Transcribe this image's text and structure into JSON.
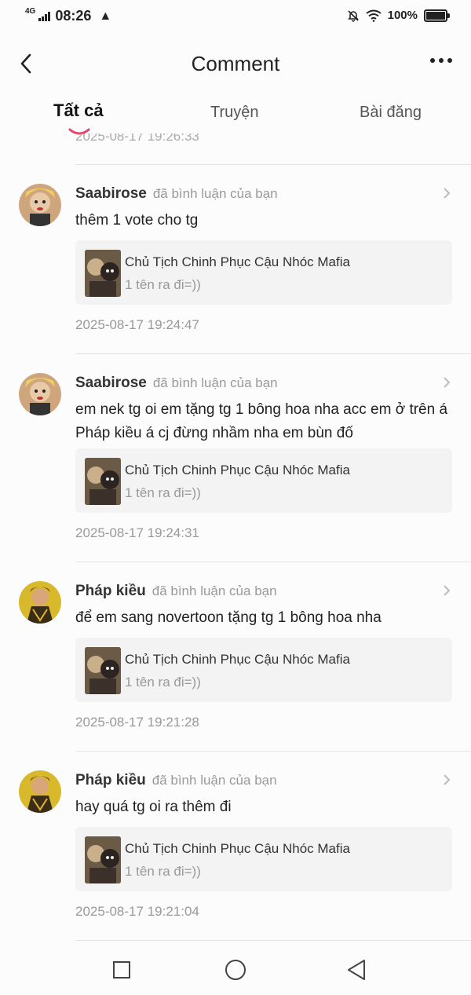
{
  "status_bar": {
    "network": "4G",
    "time": "08:26",
    "battery": "100%"
  },
  "header": {
    "title": "Comment"
  },
  "tabs": [
    {
      "label": "Tất cả",
      "active": true
    },
    {
      "label": "Truyện",
      "active": false
    },
    {
      "label": "Bài đăng",
      "active": false
    }
  ],
  "cut_timestamp": "2025-08-17 19:26:33",
  "items": [
    {
      "user": "Saabirose",
      "action": "đã bình luận của bạn",
      "text": "thêm 1 vote cho tg",
      "card_title": "Chủ Tịch Chinh Phục Cậu Nhóc Mafia",
      "card_sub": "1 tên ra đi=))",
      "timestamp": "2025-08-17 19:24:47"
    },
    {
      "user": "Saabirose",
      "action": "đã bình luận của bạn",
      "text": "em nek tg oi em tặng tg 1 bông hoa nha acc em ở trên á Pháp kiều á cj đừng nhầm nha em bùn đố",
      "card_title": "Chủ Tịch Chinh Phục Cậu Nhóc Mafia",
      "card_sub": "1 tên ra đi=))",
      "timestamp": "2025-08-17 19:24:31"
    },
    {
      "user": "Pháp kiều",
      "action": "đã bình luận của bạn",
      "text": "để em sang novertoon tặng tg 1 bông hoa nha",
      "card_title": "Chủ Tịch Chinh Phục Cậu Nhóc Mafia",
      "card_sub": "1 tên ra đi=))",
      "timestamp": "2025-08-17 19:21:28"
    },
    {
      "user": "Pháp kiều",
      "action": "đã bình luận của bạn",
      "text": "hay quá tg oi ra thêm đi",
      "card_title": "Chủ Tịch Chinh Phục Cậu Nhóc Mafia",
      "card_sub": "1 tên ra đi=))",
      "timestamp": "2025-08-17 19:21:04"
    }
  ],
  "icons": {
    "back": "back-arrow-icon",
    "more": "more-dots-icon",
    "chevron": "chevron-right-icon",
    "nav_recents": "square-icon",
    "nav_home": "circle-icon",
    "nav_back": "triangle-back-icon"
  },
  "colors": {
    "tab_indicator": "#e8436a",
    "muted_text": "#999999",
    "card_bg": "#f3f3f3"
  }
}
